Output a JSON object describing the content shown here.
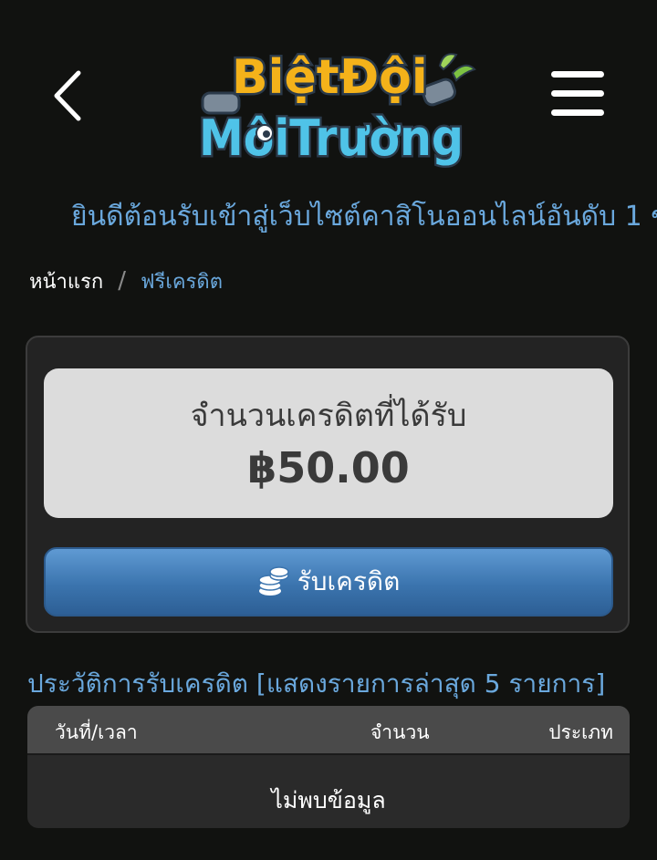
{
  "header": {
    "back_icon": "chevron-left-icon",
    "menu_icon": "hamburger-menu-icon",
    "logo": {
      "line1": "BiệtĐội",
      "line2": "MôiTrường",
      "colors": {
        "yellow": "#f4b21a",
        "orange": "#e8731f",
        "cyan": "#4fc3e8",
        "outline": "#2b3a4a"
      }
    }
  },
  "marquee": {
    "text": "ยินดีต้อนรับเข้าสู่เว็บไซต์คาสิโนออนไลน์อันดับ 1 ข"
  },
  "breadcrumb": {
    "home": "หน้าแรก",
    "separator": "/",
    "current": "ฟรีเครดิต"
  },
  "credit": {
    "label": "จำนวนเครดิตที่ได้รับ",
    "amount": "฿50.00",
    "claim_button": "รับเครดิต",
    "claim_icon": "coins-icon"
  },
  "history": {
    "title": "ประวัติการรับเครดิต [แสดงรายการล่าสุด 5 รายการ]",
    "columns": [
      "วันที่/เวลา",
      "จำนวน",
      "ประเภท"
    ],
    "empty_text": "ไม่พบข้อมูล"
  },
  "colors": {
    "background": "#111210",
    "accent_blue": "#6aa8dd",
    "button_blue": "#3b74ae",
    "card_bg": "#232323",
    "credit_box_bg": "#dcdcdc"
  }
}
